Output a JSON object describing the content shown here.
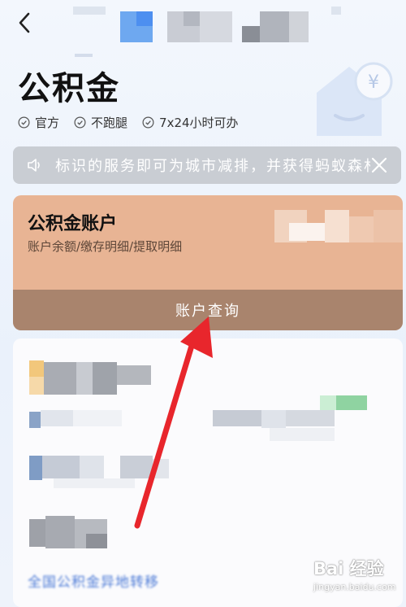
{
  "header": {
    "back_icon": "chevron-left-icon"
  },
  "hero": {
    "title": "公积金",
    "tags": [
      "官方",
      "不跑腿",
      "7x24小时可办"
    ],
    "tag_icon": "check-circle-icon",
    "illustration_icon": "house-yuan-icon"
  },
  "notice": {
    "icon": "speaker-icon",
    "text": "标识的服务即可为城市减排，并获得蚂蚁森林",
    "close_icon": "close-icon"
  },
  "account_card": {
    "title": "公积金账户",
    "subtitle": "账户余额/缴存明细/提取明细",
    "action_label": "账户查询"
  },
  "services": {
    "bottom_link": "全国公积金异地转移"
  },
  "watermark": {
    "top": "Bai 经验",
    "bottom": "jingyan.baidu.com"
  },
  "colors": {
    "card_bg": "#e8b494",
    "card_footer": "#a9846d",
    "notice_bg": "#c9cdd3",
    "arrow": "#e8262c",
    "link": "#4d7bd6"
  }
}
